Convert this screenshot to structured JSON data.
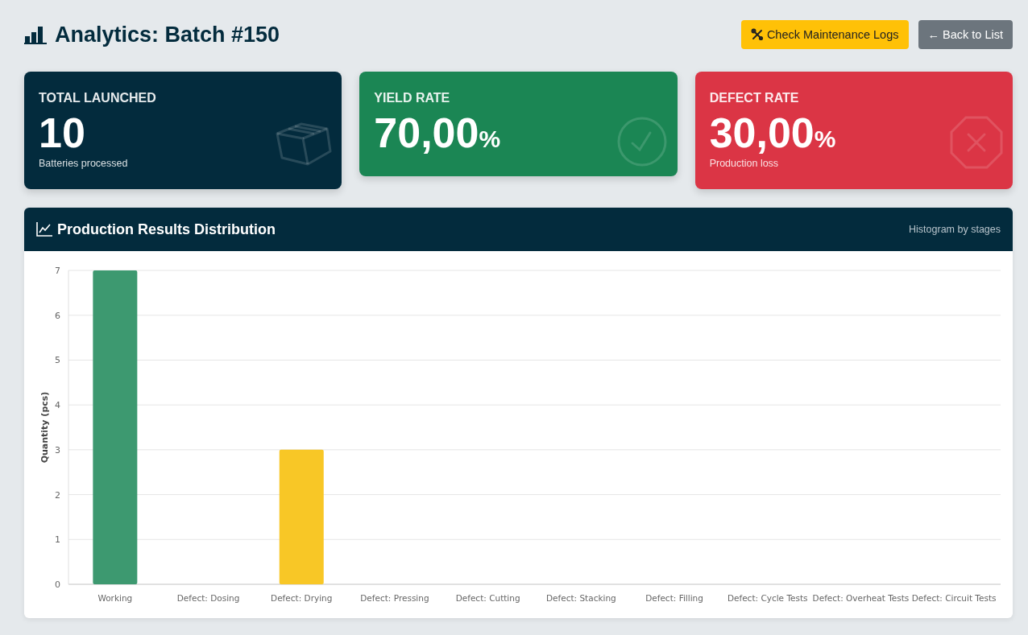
{
  "header": {
    "title": "Analytics: Batch #150",
    "buttons": [
      {
        "kind": "maintenance",
        "label": "Check Maintenance Logs"
      },
      {
        "kind": "back",
        "label": "← Back to List"
      }
    ]
  },
  "cards": [
    {
      "kind": "box",
      "color": "#032b3d",
      "title": "TOTAL LAUNCHED",
      "value": "10",
      "subtitle": "Batteries processed"
    },
    {
      "kind": "check",
      "color": "#1b8654",
      "title": "YIELD RATE",
      "value": "70,00",
      "unit": "%"
    },
    {
      "kind": "cross",
      "color": "#db3545",
      "title": "DEFECT RATE",
      "value": "30,00",
      "unit": "%",
      "subtitle": "Production loss"
    }
  ],
  "chart_panel": {
    "title": "Production Results Distribution",
    "note": "Histogram by stages",
    "chart_data": {
      "type": "bar",
      "ylabel": "Quantity (pcs)",
      "categories": [
        "Working",
        "Defect: Dosing",
        "Defect: Drying",
        "Defect: Pressing",
        "Defect: Cutting",
        "Defect: Stacking",
        "Defect: Filling",
        "Defect: Cycle Tests",
        "Defect: Overheat Tests",
        "Defect: Circuit Tests"
      ],
      "series": [
        {
          "color": "#3d9970",
          "values": [
            7,
            null,
            null,
            null,
            null,
            null,
            null,
            null,
            null,
            null
          ]
        },
        {
          "color": "#f8c726",
          "values": [
            null,
            0,
            3,
            0,
            0,
            0,
            0,
            0,
            0,
            0
          ]
        }
      ],
      "stacked": true,
      "grid": true,
      "ylim": [
        0,
        7
      ],
      "yticks": [
        0,
        1,
        2,
        3,
        4,
        5,
        6,
        7
      ]
    }
  }
}
